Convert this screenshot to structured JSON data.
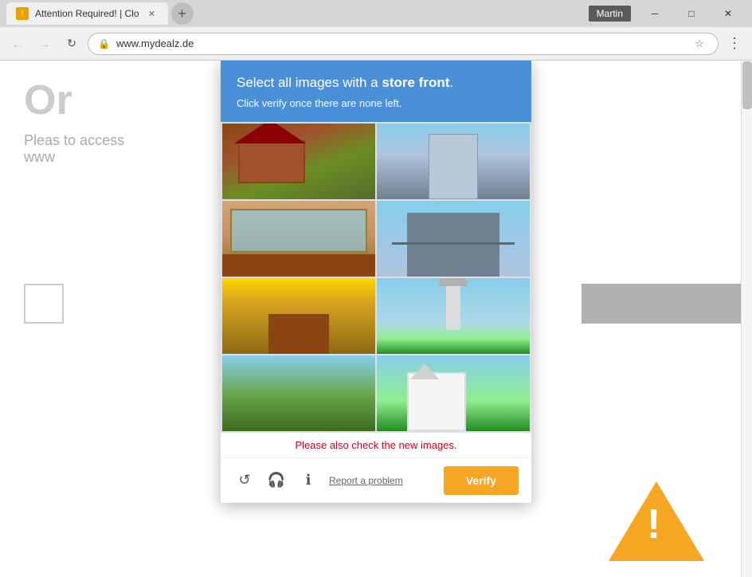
{
  "browser": {
    "title_bar": {
      "user_name": "Martin",
      "tab_title": "Attention Required! | Clo",
      "minimize_label": "─",
      "maximize_label": "□",
      "close_label": "✕",
      "new_tab_label": "+"
    },
    "address_bar": {
      "url": "www.mydealz.de",
      "back_label": "←",
      "forward_label": "→",
      "reload_label": "↻"
    }
  },
  "background": {
    "title": "Or",
    "subtitle_part1": "Pleas",
    "subtitle_part2": "to access",
    "subtitle_part3": "www"
  },
  "captcha": {
    "header": {
      "instruction_prefix": "Select all images with a ",
      "instruction_bold": "store front",
      "instruction_suffix": ".",
      "subtext": "Click verify once there are none left."
    },
    "images": [
      {
        "id": 1,
        "type": "house",
        "label": "Red brick house with garden"
      },
      {
        "id": 2,
        "type": "office-tall",
        "label": "Tall office building"
      },
      {
        "id": 3,
        "type": "storefront",
        "label": "Storefront with glass windows"
      },
      {
        "id": 4,
        "type": "modern-building",
        "label": "Modern building with trees"
      },
      {
        "id": 5,
        "type": "hall",
        "label": "Decorated hall interior"
      },
      {
        "id": 6,
        "type": "tower",
        "label": "Cylindrical tower structure"
      },
      {
        "id": 7,
        "type": "fields",
        "label": "Green rice fields landscape"
      },
      {
        "id": 8,
        "type": "white-building",
        "label": "White building with steps"
      }
    ],
    "warning_text": "Please also check the new images.",
    "footer": {
      "reload_label": "↺",
      "audio_label": "🎧",
      "info_label": "ℹ",
      "report_label": "Report a problem",
      "verify_label": "Verify"
    }
  },
  "warning_icon": {
    "symbol": "!"
  }
}
